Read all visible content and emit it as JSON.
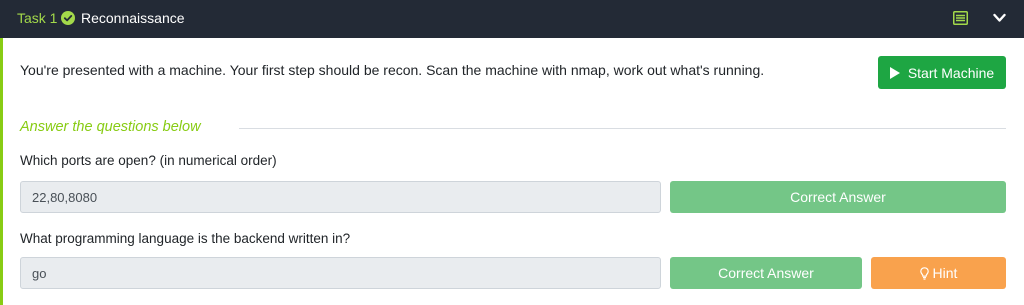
{
  "task": {
    "number_label": "Task 1",
    "title": "Reconnaissance",
    "completed": true
  },
  "colors": {
    "header_bg": "#232a36",
    "accent_green": "#88cc14",
    "start_button": "#1ea643",
    "correct_button": "#74c687",
    "hint_button": "#f9a24d",
    "field_bg": "#e9ecef"
  },
  "icons": {
    "status": "check-circle-icon",
    "view": "list-icon",
    "collapse": "chevron-down-icon",
    "start": "play-icon",
    "hint": "lightbulb-icon"
  },
  "intro": "You're presented with a machine. Your first step should be recon. Scan the machine with nmap, work out what's running.",
  "start_button_label": "Start Machine",
  "answers_heading": "Answer the questions below",
  "questions": [
    {
      "text": "Which ports are open? (in numerical order)",
      "answer": "22,80,8080",
      "status_label": "Correct Answer"
    },
    {
      "text": "What programming language is the backend written in?",
      "answer": "go",
      "status_label": "Correct Answer",
      "hint_label": "Hint"
    }
  ]
}
